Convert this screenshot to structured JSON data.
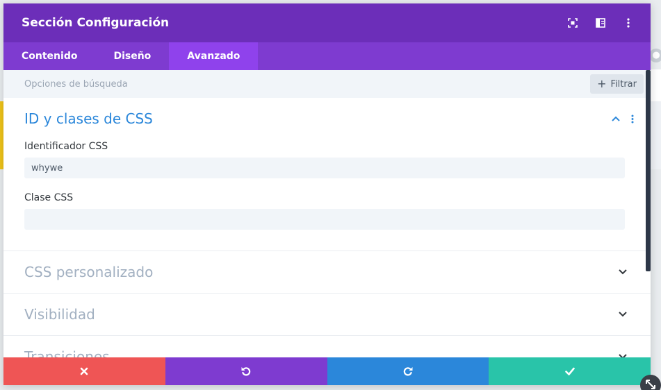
{
  "modal": {
    "title": "Sección Configuración",
    "header_icons": [
      "expand-icon",
      "sidebar-layout-icon",
      "kebab-menu-icon"
    ]
  },
  "tabs": [
    {
      "label": "Contenido",
      "active": false
    },
    {
      "label": "Diseño",
      "active": false
    },
    {
      "label": "Avanzado",
      "active": true
    }
  ],
  "search": {
    "placeholder": "Opciones de búsqueda",
    "filter_label": "Filtrar"
  },
  "sections": {
    "css_ids": {
      "title": "ID y clases de CSS",
      "expanded": true,
      "id_label": "Identificador CSS",
      "id_value": "whywe",
      "class_label": "Clase CSS",
      "class_value": ""
    },
    "custom_css": {
      "title": "CSS personalizado",
      "expanded": false
    },
    "visibility": {
      "title": "Visibilidad",
      "expanded": false
    },
    "transitions": {
      "title": "Transiciones",
      "expanded": false
    }
  },
  "footer": {
    "buttons": [
      "discard-icon",
      "undo-icon",
      "redo-icon",
      "save-check-icon"
    ]
  },
  "colors": {
    "header": "#6c2eb9",
    "tabs": "#7e3bd0",
    "tab_active": "#8f42ec",
    "accent_blue": "#2b87da",
    "discard": "#ef5555",
    "undo": "#7e3bd0",
    "redo": "#2b87da",
    "save": "#29c4a9"
  }
}
